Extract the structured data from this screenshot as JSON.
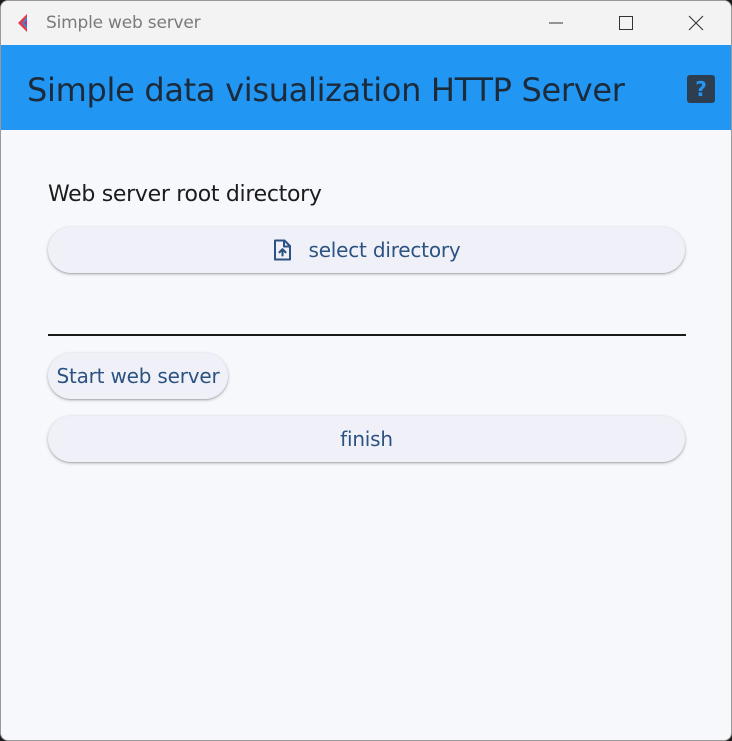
{
  "window": {
    "title": "Simple web server",
    "controls": {
      "minimize_icon": "minimize-icon",
      "maximize_icon": "maximize-icon",
      "close_icon": "close-icon"
    }
  },
  "appbar": {
    "title": "Simple data visualization HTTP Server",
    "help_label": "?",
    "color": "#2196f3"
  },
  "main": {
    "root_dir_label": "Web server root directory",
    "select_directory_button": {
      "label": "select directory",
      "icon": "file-upload-icon"
    },
    "selected_directory_value": "",
    "start_button": "Start web server",
    "finish_button": "finish"
  },
  "colors": {
    "accent": "#2196f3",
    "button_text": "#2c5282",
    "background": "#f7f8fc"
  }
}
